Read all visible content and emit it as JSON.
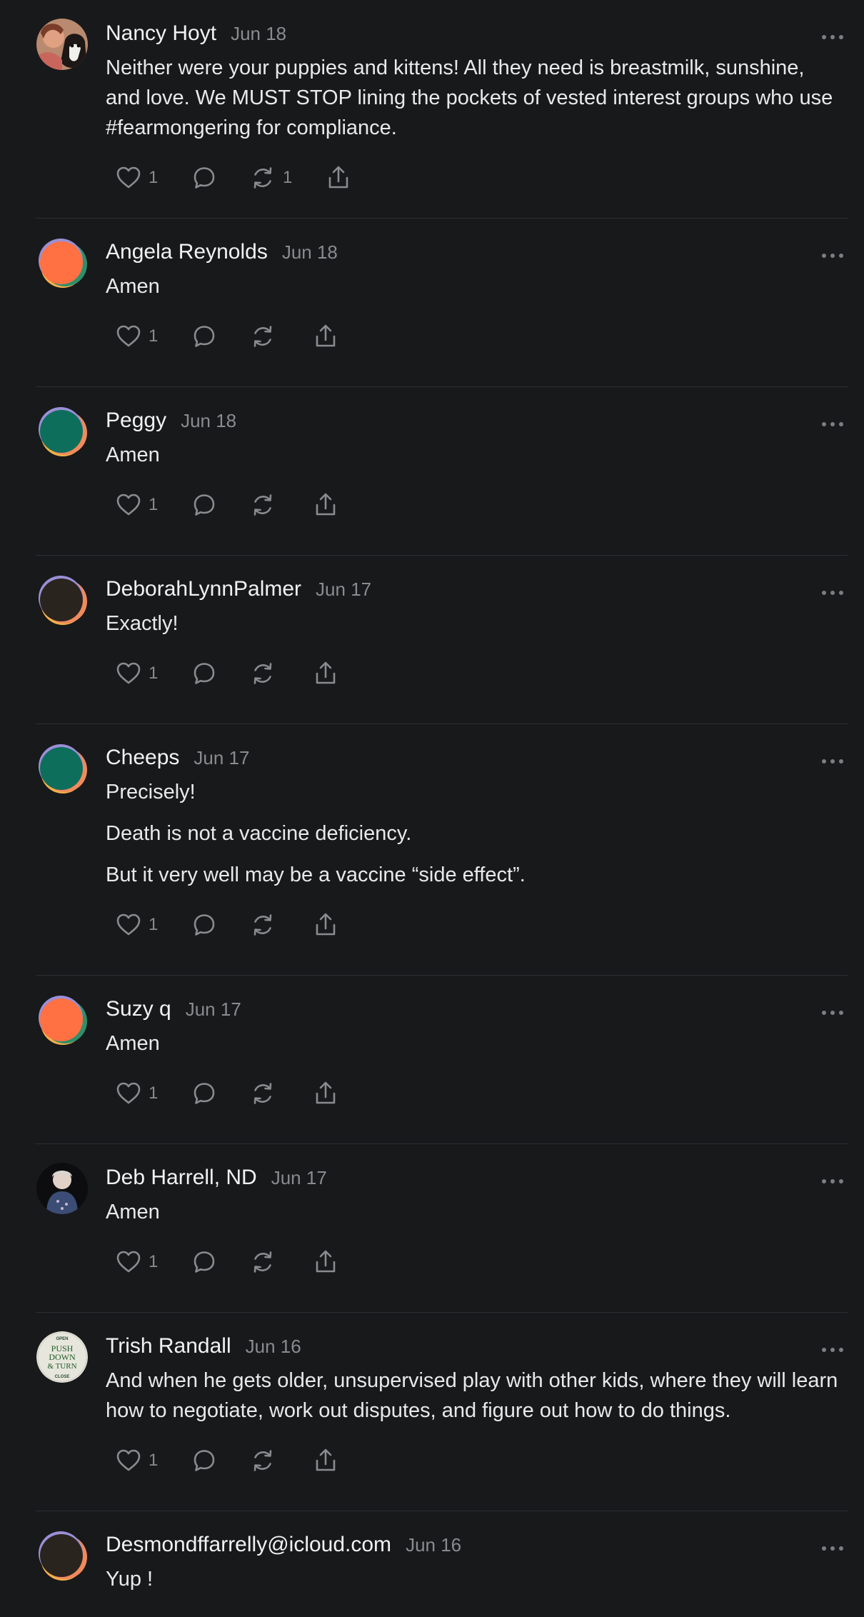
{
  "comments": [
    {
      "name": "Nancy Hoyt",
      "date": "Jun 18",
      "paragraphs": [
        "Neither were your puppies and kittens! All they need is breastmilk, sunshine, and love. We MUST STOP lining the pockets of vested interest groups who use #fearmongering for compliance."
      ],
      "likes": "1",
      "restacks": "1",
      "avatar": "photo-woman-with-dog"
    },
    {
      "name": "Angela Reynolds",
      "date": "Jun 18",
      "paragraphs": [
        "Amen"
      ],
      "likes": "1",
      "restacks": "",
      "avatar": "default-orange"
    },
    {
      "name": "Peggy",
      "date": "Jun 18",
      "paragraphs": [
        "Amen"
      ],
      "likes": "1",
      "restacks": "",
      "avatar": "default-teal"
    },
    {
      "name": "DeborahLynnPalmer",
      "date": "Jun 17",
      "paragraphs": [
        "Exactly!"
      ],
      "likes": "1",
      "restacks": "",
      "avatar": "default-dark"
    },
    {
      "name": "Cheeps",
      "date": "Jun 17",
      "paragraphs": [
        "Precisely!",
        "Death is not a vaccine deficiency.",
        "But it very well may be a vaccine “side effect”."
      ],
      "likes": "1",
      "restacks": "",
      "avatar": "default-teal"
    },
    {
      "name": "Suzy q",
      "date": "Jun 17",
      "paragraphs": [
        "Amen"
      ],
      "likes": "1",
      "restacks": "",
      "avatar": "default-orange"
    },
    {
      "name": "Deb Harrell, ND",
      "date": "Jun 17",
      "paragraphs": [
        "Amen"
      ],
      "likes": "1",
      "restacks": "",
      "avatar": "photo-woman-portrait"
    },
    {
      "name": "Trish Randall",
      "date": "Jun 16",
      "paragraphs": [
        "And when he gets older, unsupervised play with other kids, where they will learn how to negotiate, work out disputes, and figure out how to do things."
      ],
      "likes": "1",
      "restacks": "",
      "avatar": "push-down-turn-badge",
      "avatar_text": {
        "top": "OPEN",
        "l1": "PUSH",
        "l2": "DOWN",
        "l3": "& TURN",
        "bottom": "CLOSE"
      }
    },
    {
      "name": "Desmondffarrelly@icloud.com",
      "date": "Jun 16",
      "paragraphs": [
        "Yup !"
      ],
      "likes": "",
      "restacks": "",
      "avatar": "default-dark"
    }
  ],
  "icons": {
    "like": "heart-icon",
    "reply": "comment-bubble-icon",
    "restack": "restack-icon",
    "share": "share-icon",
    "more": "more-options-icon"
  },
  "colors": {
    "background": "#18191b",
    "divider": "#2e2f32",
    "text": "#e9e9e9",
    "muted": "#8a8b8e"
  }
}
